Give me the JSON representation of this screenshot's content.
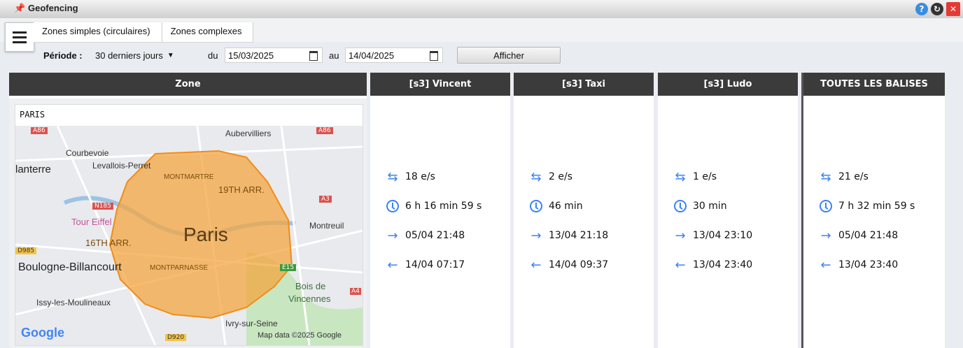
{
  "window": {
    "title": "Geofencing"
  },
  "tabs": [
    {
      "label": "Zones simples (circulaires)"
    },
    {
      "label": "Zones complexes"
    }
  ],
  "filters": {
    "period_label": "Période :",
    "period_value": "30 derniers jours",
    "from_label": "du",
    "from_date": "15/03/2025",
    "to_label": "au",
    "to_date": "14/04/2025",
    "show_button": "Afficher"
  },
  "columns": {
    "zone_header": "Zone",
    "zone_name": "PARIS",
    "beacons": [
      {
        "header": "[s3] Vincent",
        "entries": "18 e/s",
        "duration": "6 h 16 min 59 s",
        "first_in": "05/04 21:48",
        "last_out": "14/04 07:17"
      },
      {
        "header": "[s3] Taxi",
        "entries": "2 e/s",
        "duration": "46 min",
        "first_in": "13/04 21:18",
        "last_out": "14/04 09:37"
      },
      {
        "header": "[s3] Ludo",
        "entries": "1 e/s",
        "duration": "30 min",
        "first_in": "13/04 23:10",
        "last_out": "13/04 23:40"
      },
      {
        "header": "TOUTES LES BALISES",
        "entries": "21 e/s",
        "duration": "7 h 32 min 59 s",
        "first_in": "05/04 21:48",
        "last_out": "13/04 23:40"
      }
    ]
  },
  "map": {
    "labels": {
      "aubervilliers": "Aubervilliers",
      "courbevoie": "Courbevoie",
      "nanterre": "lanterre",
      "levallois": "Levallois-Perret",
      "montmartre": "MONTMARTRE",
      "arr19": "19TH ARR.",
      "tour_eiffel": "Tour Eiffel",
      "paris": "Paris",
      "montreuil": "Montreuil",
      "arr16": "16TH ARR.",
      "boulogne": "Boulogne-Billancourt",
      "montparnasse": "MONTPARNASSE",
      "bois": "Bois de",
      "vincennes": "Vincennes",
      "issy": "Issy-les-Moulineaux",
      "ivry": "Ivry-sur-Seine",
      "google": "Google",
      "attribution": "Map data ©2025 Google",
      "a86_1": "A86",
      "a86_2": "A86",
      "n185": "N185",
      "a3": "A3",
      "d985": "D985",
      "e15": "E15",
      "a4": "A4",
      "d920": "D920"
    },
    "colors": {
      "zone_fill": "#f4a540",
      "water": "#9cc3e6",
      "park": "#c8e6c0"
    }
  }
}
